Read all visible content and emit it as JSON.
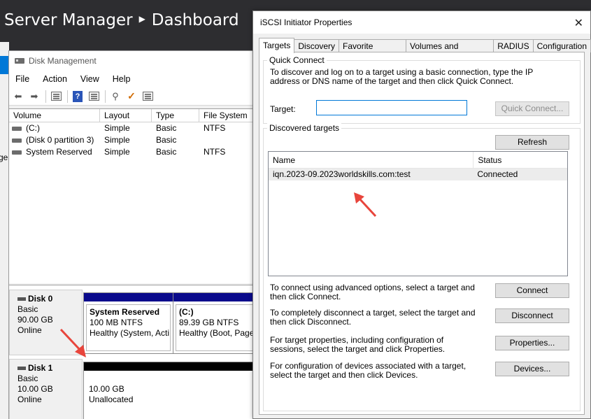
{
  "server_manager": {
    "title": "Server Manager",
    "breadcrumb_current": "Dashboard",
    "partial_left_text": "ge",
    "colors": {
      "header_bg": "#2d2d30",
      "accent": "#0078d7"
    }
  },
  "disk_management": {
    "title": "Disk Management",
    "menu": [
      "File",
      "Action",
      "View",
      "Help"
    ],
    "toolbar_icons": [
      "back-arrow-icon",
      "forward-arrow-icon",
      "console-tree-icon",
      "help-icon",
      "properties-icon",
      "connect-icon",
      "checklist-icon",
      "list-view-icon"
    ],
    "volume_columns": [
      "Volume",
      "Layout",
      "Type",
      "File System"
    ],
    "volumes": [
      {
        "volume": "(C:)",
        "layout": "Simple",
        "type": "Basic",
        "fs": "NTFS"
      },
      {
        "volume": "(Disk 0 partition 3)",
        "layout": "Simple",
        "type": "Basic",
        "fs": ""
      },
      {
        "volume": "System Reserved",
        "layout": "Simple",
        "type": "Basic",
        "fs": "NTFS"
      }
    ],
    "disks": [
      {
        "name": "Disk 0",
        "kind": "Basic",
        "size": "90.00 GB",
        "state": "Online",
        "partitions": [
          {
            "name": "System Reserved",
            "detail": "100 MB NTFS",
            "health": "Healthy (System, Acti"
          },
          {
            "name": "(C:)",
            "detail": "89.39 GB NTFS",
            "health": "Healthy (Boot, Page"
          }
        ]
      },
      {
        "name": "Disk 1",
        "kind": "Basic",
        "size": "10.00 GB",
        "state": "Online",
        "partitions": [
          {
            "name": "",
            "detail": "10.00 GB",
            "health": "Unallocated"
          }
        ]
      }
    ],
    "colors": {
      "primary_partition_bar": "#0a0a8c",
      "unallocated_bar": "#000000",
      "annotation_arrow": "#e8453c"
    }
  },
  "iscsi": {
    "title": "iSCSI Initiator Properties",
    "close_glyph": "✕",
    "tabs": [
      {
        "label": "Targets",
        "active": true
      },
      {
        "label": "Discovery",
        "active": false
      },
      {
        "label": "Favorite Targets",
        "active": false
      },
      {
        "label": "Volumes and Devices",
        "active": false
      },
      {
        "label": "RADIUS",
        "active": false
      },
      {
        "label": "Configuration",
        "active": false
      }
    ],
    "quick_connect": {
      "group_title": "Quick Connect",
      "description": "To discover and log on to a target using a basic connection, type the IP address or DNS name of the target and then click Quick Connect.",
      "target_label": "Target:",
      "target_value": "",
      "button": "Quick Connect..."
    },
    "discovered": {
      "group_title": "Discovered targets",
      "refresh_button": "Refresh",
      "columns": [
        "Name",
        "Status"
      ],
      "rows": [
        {
          "name": "iqn.2023-09.2023worldskills.com:test",
          "status": "Connected"
        }
      ]
    },
    "actions": [
      {
        "text": "To connect using advanced options, select a target and then click Connect.",
        "button": "Connect"
      },
      {
        "text": "To completely disconnect a target, select the target and then click Disconnect.",
        "button": "Disconnect"
      },
      {
        "text": "For target properties, including configuration of sessions, select the target and click Properties.",
        "button": "Properties..."
      },
      {
        "text": "For configuration of devices associated with a target, select the target and then click Devices.",
        "button": "Devices..."
      }
    ]
  }
}
